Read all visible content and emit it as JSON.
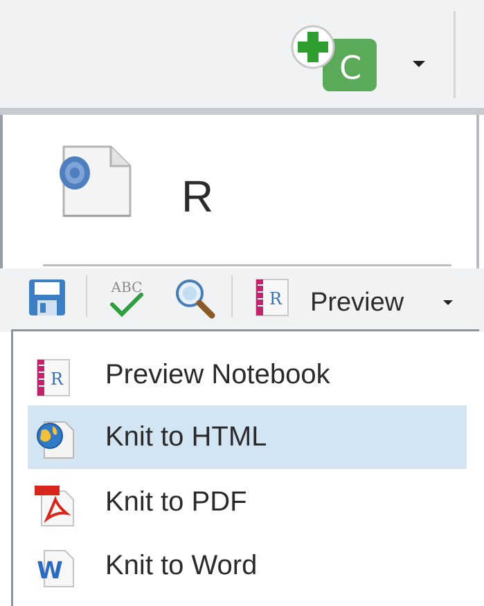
{
  "toolbar": {
    "new_file_badge": "C"
  },
  "tab": {
    "label": "R"
  },
  "editor_toolbar": {
    "preview_label": "Preview"
  },
  "menu": {
    "items": [
      {
        "label": "Preview Notebook",
        "icon": "r-notebook-icon"
      },
      {
        "label": "Knit to HTML",
        "icon": "html-globe-icon",
        "highlighted": true
      },
      {
        "label": "Knit to PDF",
        "icon": "pdf-icon"
      },
      {
        "label": "Knit to Word",
        "icon": "word-icon"
      }
    ]
  },
  "icons": {
    "spellcheck_text": "ABC",
    "notebook_letter": "R",
    "word_letter": "W"
  },
  "colors": {
    "highlight": "#d3e4f3",
    "new_file_green": "#5aaa5a",
    "plus_green": "#2e9e2e"
  }
}
